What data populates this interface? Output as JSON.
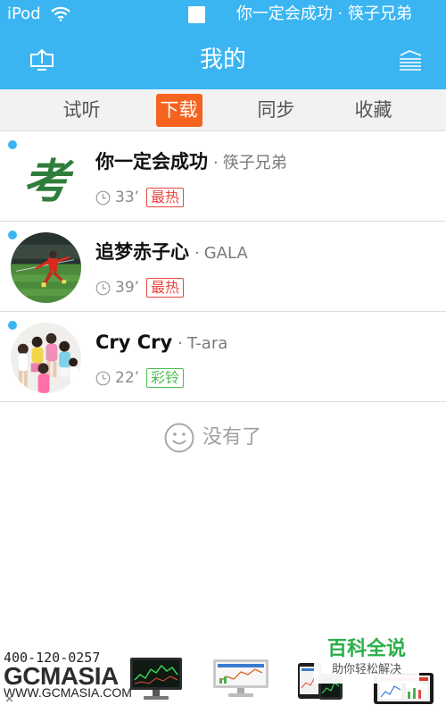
{
  "status_bar": {
    "carrier": "iPod",
    "now_playing": "你一定会成功 · 筷子兄弟",
    "icons": {
      "wifi": "wifi-icon",
      "stop": "stop-icon"
    }
  },
  "header": {
    "title": "我的",
    "left_button_icon": "upload-icon",
    "right_button_icon": "playlist-icon"
  },
  "tabs": [
    {
      "label": "试听",
      "active": false
    },
    {
      "label": "下载",
      "active": true
    },
    {
      "label": "同步",
      "active": false
    },
    {
      "label": "收藏",
      "active": false
    }
  ],
  "songs": [
    {
      "title": "你一定会成功",
      "separator": "·",
      "artist": "筷子兄弟",
      "duration": "33’",
      "badge": "最热",
      "badge_color": "#e8473f",
      "cover_text": "考",
      "unread": true
    },
    {
      "title": "追梦赤子心",
      "separator": "·",
      "artist": "GALA",
      "duration": "39’",
      "badge": "最热",
      "badge_color": "#e8473f",
      "unread": true
    },
    {
      "title": "Cry Cry",
      "separator": "·",
      "artist": "T-ara",
      "duration": "22’",
      "badge": "彩铃",
      "badge_color": "#4cbf4f",
      "unread": true
    }
  ],
  "empty_state": {
    "text": "没有了",
    "icon": "smiley-icon"
  },
  "ad_banner": {
    "phone": "400-120-0257",
    "brand": "GCMASIA",
    "website": "WWW.GCMASIA.COM",
    "close_label": "×"
  },
  "watermark": {
    "title": "百科全说",
    "subtitle": "助你轻松解决"
  },
  "colors": {
    "primary": "#3ab5f2",
    "active_tab": "#f4631f",
    "watermark": "#2bb04a"
  }
}
